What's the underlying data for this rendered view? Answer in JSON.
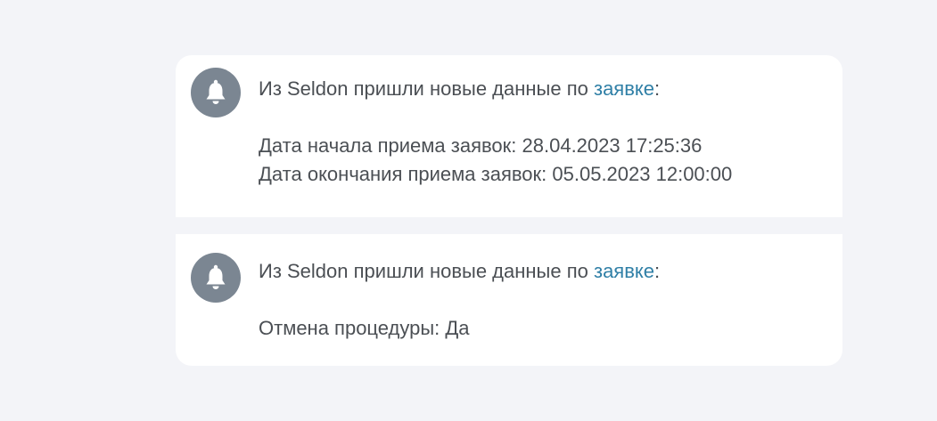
{
  "notifications": [
    {
      "icon": "bell-icon",
      "intro_prefix": "Из Seldon пришли новые данные по ",
      "link_text": "заявке",
      "intro_suffix": ":",
      "details": [
        "Дата начала приема заявок: 28.04.2023 17:25:36",
        "Дата окончания приема заявок: 05.05.2023 12:00:00"
      ]
    },
    {
      "icon": "bell-icon",
      "intro_prefix": "Из Seldon пришли новые данные по ",
      "link_text": "заявке",
      "intro_suffix": ":",
      "details": [
        "Отмена процедуры: Да"
      ]
    }
  ],
  "colors": {
    "page_background": "#f3f4f8",
    "card_background": "#ffffff",
    "icon_circle": "#7b8692",
    "text": "#4b4f54",
    "link": "#2f7fa6"
  }
}
